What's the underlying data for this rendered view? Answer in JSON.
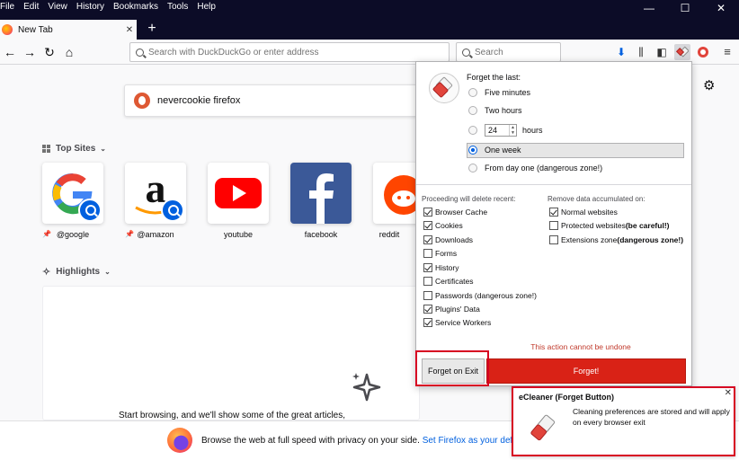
{
  "menubar": {
    "items": [
      "File",
      "Edit",
      "View",
      "History",
      "Bookmarks",
      "Tools",
      "Help"
    ],
    "minimize": "—",
    "maximize": "☐",
    "close": "✕"
  },
  "tabs": {
    "active_title": "New Tab",
    "close_glyph": "✕",
    "new_tab_glyph": "+"
  },
  "navbar": {
    "back_glyph": "←",
    "forward_glyph": "→",
    "reload_glyph": "↻",
    "home_glyph": "⌂",
    "url_placeholder": "Search with DuckDuckGo or enter address",
    "search_placeholder": "Search",
    "icons": [
      "downloads-icon",
      "library-icon",
      "sidebar-icon",
      "ecleaner-icon",
      "extension-icon",
      "menu-icon"
    ]
  },
  "newtab": {
    "search_value": "nevercookie firefox",
    "top_sites_label": "Top Sites",
    "highlights_label": "Highlights",
    "settings_glyph": "⚙",
    "top_sites": [
      {
        "label": "@google",
        "pinned": true
      },
      {
        "label": "@amazon",
        "pinned": true
      },
      {
        "label": "youtube",
        "pinned": false
      },
      {
        "label": "facebook",
        "pinned": false
      },
      {
        "label": "reddit",
        "pinned": false
      }
    ],
    "highlights_message": "Start browsing, and we'll show some of the great articles,",
    "banner_text": "Browse the web at full speed with privacy on your side.",
    "banner_link": "Set Firefox as your defa"
  },
  "popup": {
    "forget_title": "Forget the last:",
    "ranges": [
      {
        "label": "Five minutes",
        "checked": false
      },
      {
        "label": "Two hours",
        "checked": false
      },
      {
        "label": "hours",
        "checked": false,
        "spinner_value": "24"
      },
      {
        "label": "One week",
        "checked": true
      },
      {
        "label": "From day one (dangerous zone!)",
        "checked": false
      }
    ],
    "left_heading": "Proceeding will delete recent:",
    "left_items": [
      {
        "label": "Browser Cache",
        "checked": true
      },
      {
        "label": "Cookies",
        "checked": true
      },
      {
        "label": "Downloads",
        "checked": true
      },
      {
        "label": "Forms",
        "checked": false
      },
      {
        "label": "History",
        "checked": true
      },
      {
        "label": "Certificates",
        "checked": false
      },
      {
        "label": "Passwords (dangerous zone!)",
        "checked": false
      },
      {
        "label": "Plugins' Data",
        "checked": true
      },
      {
        "label": "Service Workers",
        "checked": true
      }
    ],
    "right_heading": "Remove data accumulated on:",
    "right_items": [
      {
        "label": "Normal websites",
        "checked": true,
        "note": ""
      },
      {
        "label": "Protected websites ",
        "checked": false,
        "note": "(be careful!)"
      },
      {
        "label": "Extensions zone ",
        "checked": false,
        "note": "(dangerous zone!)"
      }
    ],
    "warning": "This action cannot be undone",
    "forget_on_exit_label": "Forget on Exit",
    "forget_label": "Forget!",
    "accent_color": "#d92216"
  },
  "notification": {
    "title": "eCleaner (Forget Button)",
    "body": "Cleaning preferences are stored and will apply on every browser exit",
    "close_glyph": "✕"
  }
}
